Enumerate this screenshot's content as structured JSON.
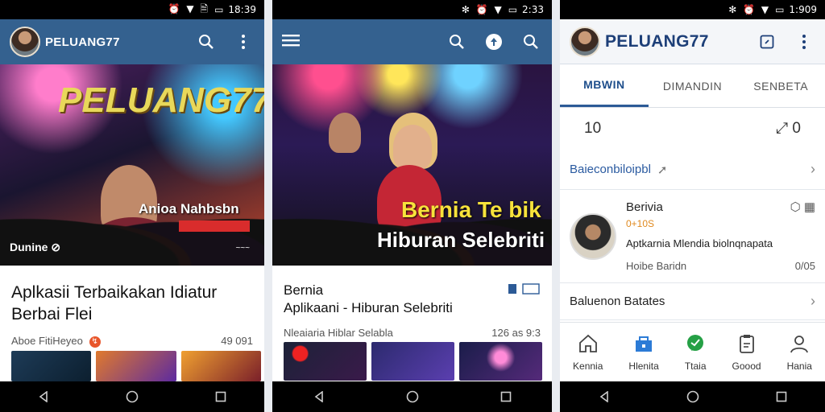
{
  "screens": [
    {
      "status": {
        "time": "18:39",
        "icons": "⏰ ▼ 🗎"
      },
      "appbar": {
        "title": "PELUANG77"
      },
      "hero": {
        "logo": "PELUANG77",
        "banner": "Anioa Nahbsbn",
        "caption_left": "Dunine ⊘",
        "caption_right": "~~~"
      },
      "content": {
        "title_line1": "Aplkasii Terbaikakan Idiatur",
        "title_line2": "Berbai Flei",
        "meta_left": "Aboe FitiHeyeo",
        "meta_badge": "↯",
        "meta_right": "49 091"
      }
    },
    {
      "status": {
        "time": "2:33",
        "icons": "✻ ⏰ ▼"
      },
      "hero": {
        "yellow": "Bernia Te bik",
        "white": "Hiburan Selebriti"
      },
      "content": {
        "title_line1": "Bernia",
        "title_line2": "Aplikaani - Hiburan Selebriti",
        "meta_left": "Nleaiaria Hiblar Selabla",
        "meta_right": "126 as 9:3"
      }
    },
    {
      "status": {
        "time": "1:909",
        "icons": "✻ ⏰ ▼"
      },
      "appbar": {
        "title": "PELUANG77"
      },
      "tabs": [
        {
          "label": "MBWIN",
          "active": true
        },
        {
          "label": "DIMANDIN",
          "active": false
        },
        {
          "label": "SENBETA",
          "active": false
        }
      ],
      "stats": {
        "left": "10",
        "right": "⤢ 0"
      },
      "row1": {
        "label": "Baieconbiloipbl"
      },
      "profile": {
        "name": "Berivia",
        "sub": "0+10S",
        "desc": "Aptkarnia Mlendia biolnqnapata",
        "foot": "Hoibe Baridn",
        "foot_right": "0/05"
      },
      "row2": {
        "label": "Baluenon Batates"
      },
      "bottom_nav": [
        {
          "label": "Kennia",
          "icon": "home-icon"
        },
        {
          "label": "Hlenita",
          "icon": "store-icon"
        },
        {
          "label": "Ttaia",
          "icon": "chat-icon"
        },
        {
          "label": "Goood",
          "icon": "clipboard-icon"
        },
        {
          "label": "Hania",
          "icon": "person-icon"
        }
      ]
    }
  ],
  "colors": {
    "appbar": "#34618f",
    "accent": "#2c5a96",
    "statusbar": "#000000"
  }
}
